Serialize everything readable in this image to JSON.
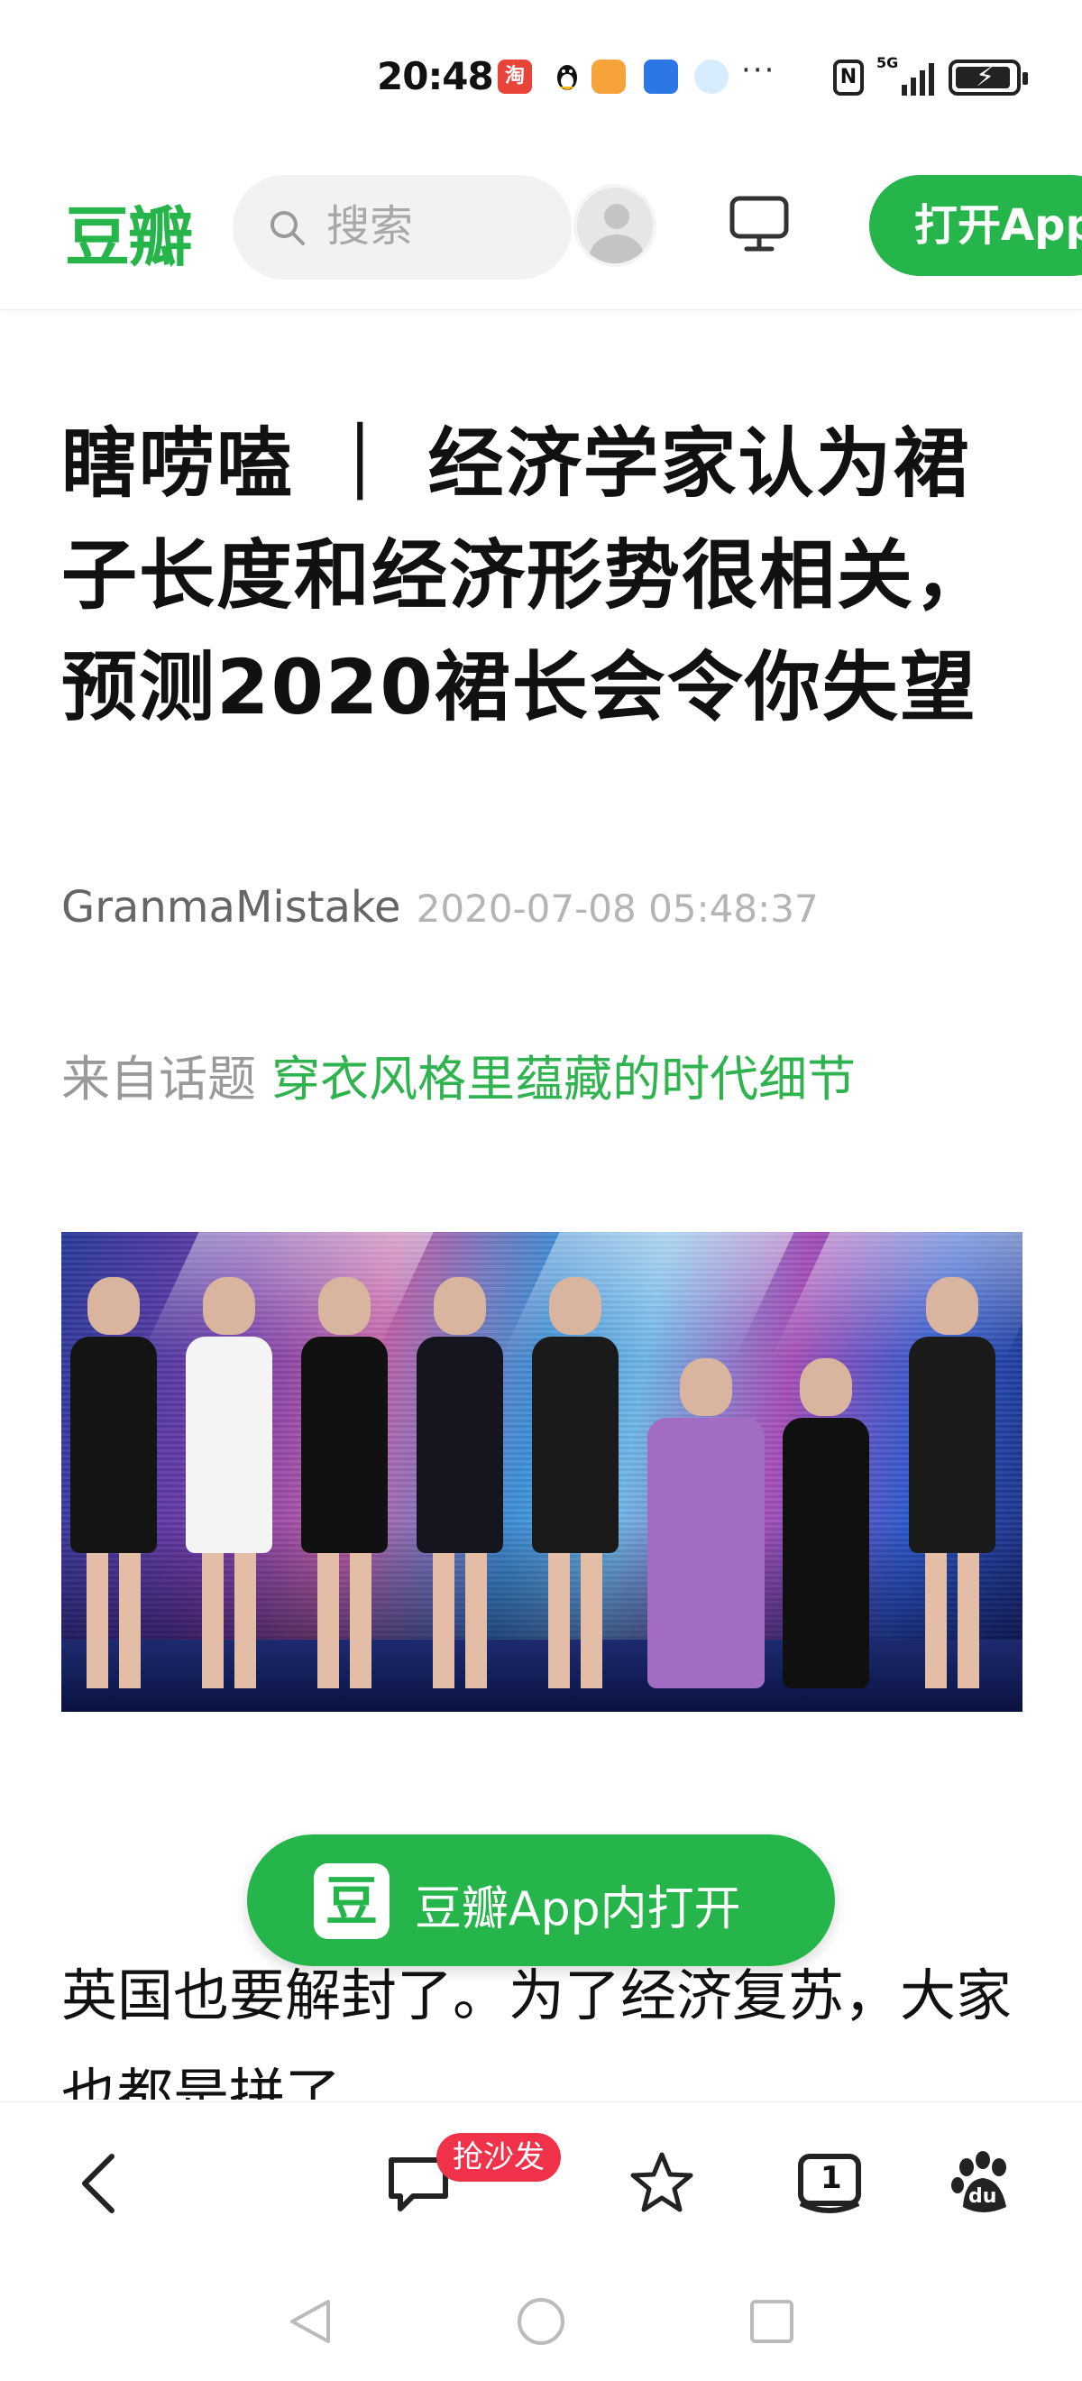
{
  "status_bar": {
    "time": "20:48",
    "taobao_icon_text": "淘",
    "more": "···",
    "nfc": "N",
    "network": "5G"
  },
  "header": {
    "logo": "豆瓣",
    "search_placeholder": "搜索",
    "open_app_label": "打开App"
  },
  "article": {
    "title": "瞎唠嗑 ｜ 经济学家认为裙子长度和经济形势很相关，预测2020裙长会令你失望",
    "author": "GranmaMistake",
    "date": "2020-07-08 05:48:37",
    "topic_prefix": "来自话题",
    "topic_name": "穿衣风格里蕴藏的时代细节",
    "body_text": "英国也要解封了。为了经济复苏，大家也都是拼了"
  },
  "float_button": {
    "logo_char": "豆",
    "label": "豆瓣App内打开"
  },
  "toolbar": {
    "comment_badge": "抢沙发",
    "count_badge": "1",
    "baidu_label": "du"
  },
  "colors": {
    "accent": "#25b54a",
    "badge": "#f0334a"
  }
}
